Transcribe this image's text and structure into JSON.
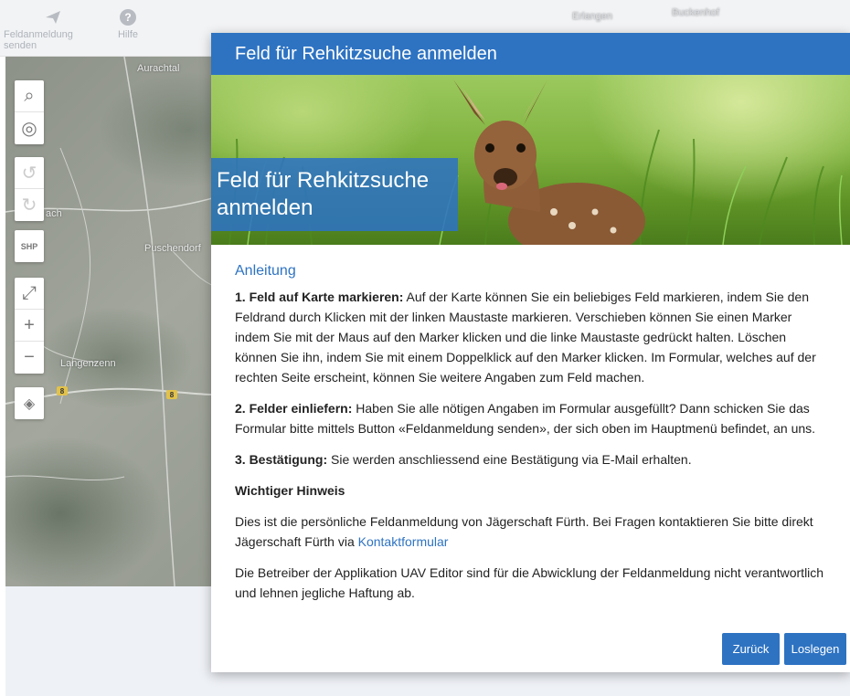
{
  "toolbar": {
    "send_label": "Feldanmeldung senden",
    "help_label": "Hilfe",
    "help_glyph": "?"
  },
  "map": {
    "places": [
      "Aurachtal",
      "Puschendorf",
      "Langenzenn",
      "Erlangen",
      "Buckenhof",
      "ach"
    ],
    "road_signs": [
      "8",
      "8"
    ]
  },
  "controls": {
    "search": "⌕",
    "locate": "◎",
    "undo": "↺",
    "redo": "↻",
    "shp": "SHP",
    "fullscreen": "⤢",
    "zoom_in": "+",
    "zoom_out": "−",
    "layers": "◈"
  },
  "dialog": {
    "header": "Feld für Rehkitzsuche anmelden",
    "banner_title": "Feld für Rehkitzsuche anmelden",
    "section_title": "Anleitung",
    "step1_label": "1. Feld auf Karte markieren:",
    "step1_text": " Auf der Karte können Sie ein beliebiges Feld markieren, indem Sie den Feldrand durch Klicken mit der linken Maustaste markieren. Verschieben können Sie einen Marker indem Sie mit der Maus auf den Marker klicken und die linke Maustaste gedrückt halten. Löschen können Sie ihn, indem Sie mit einem Doppelklick auf den Marker klicken. Im Formular, welches auf der rechten Seite erscheint, können Sie weitere Angaben zum Feld machen.",
    "step2_label": "2. Felder einliefern:",
    "step2_text": " Haben Sie alle nötigen Angaben im Formular ausgefüllt? Dann schicken Sie das Formular bitte mittels Button «Feldanmeldung senden», der sich oben im Hauptmenü befindet, an uns.",
    "step3_label": "3. Bestätigung:",
    "step3_text": " Sie werden anschliessend eine Bestätigung via E-Mail erhalten.",
    "hint_title": "Wichtiger Hinweis",
    "hint_text": "Dies ist die persönliche Feldanmeldung von Jägerschaft Fürth. Bei Fragen kontaktieren Sie bitte direkt Jägerschaft Fürth via ",
    "contact_link": "Kontaktformular",
    "disclaimer": "Die Betreiber der Applikation UAV Editor sind für die Abwicklung der Feldanmeldung nicht verantwortlich und lehnen jegliche Haftung ab.",
    "back_button": "Zurück",
    "start_button": "Loslegen"
  }
}
